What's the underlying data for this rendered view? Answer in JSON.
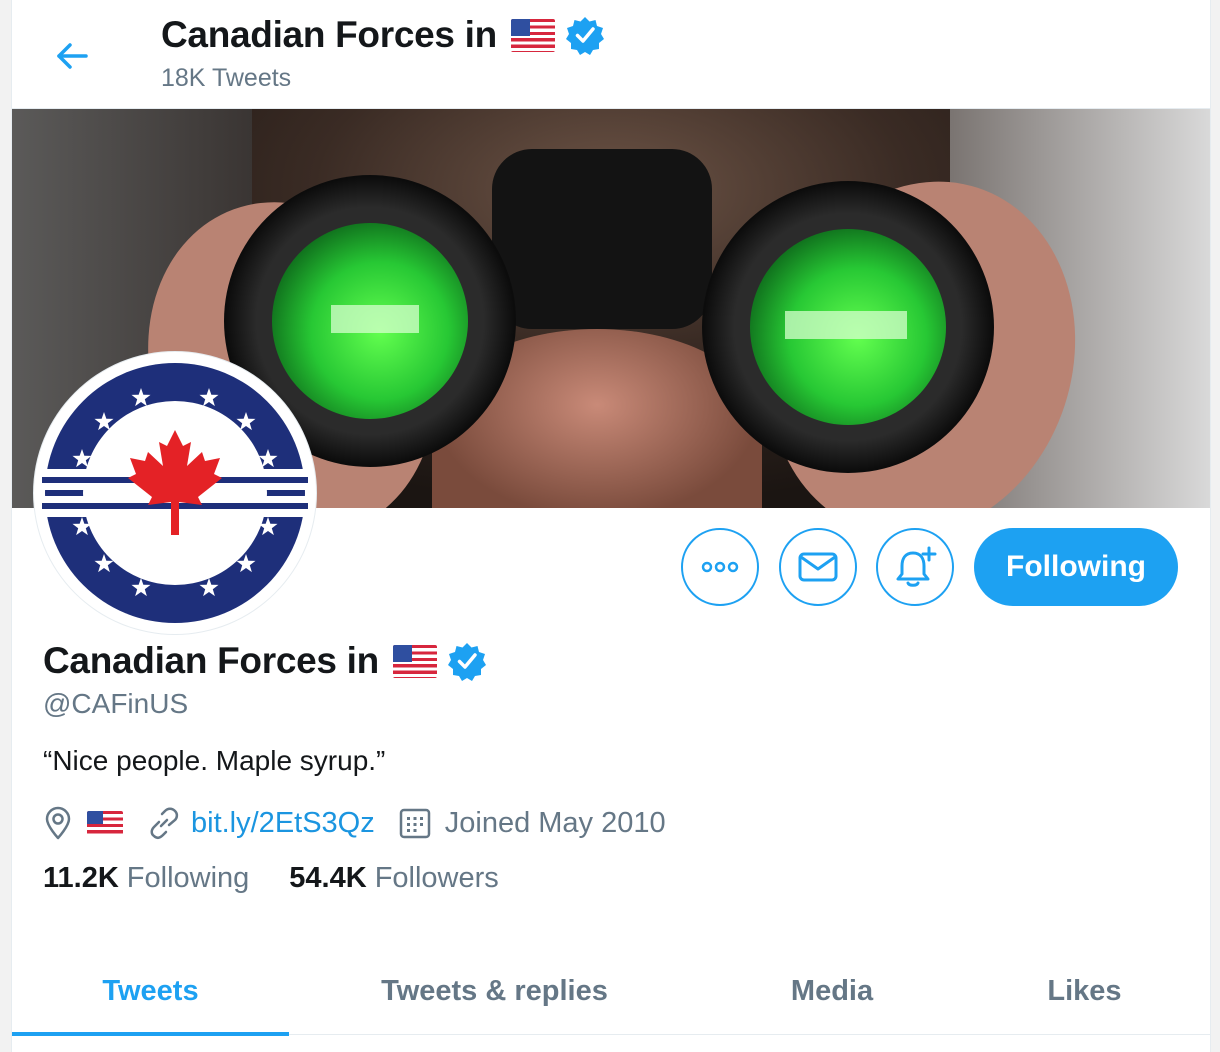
{
  "header": {
    "back_label": "Back",
    "title": "Canadian Forces in",
    "tweet_count": "18K Tweets"
  },
  "profile": {
    "name": "Canadian Forces in",
    "handle": "@CAFinUS",
    "bio": "“Nice people. Maple syrup.”",
    "location_flag": "us-flag-icon",
    "website": "bit.ly/2EtS3Qz",
    "joined": "Joined May 2010",
    "following_count": "11.2K",
    "following_label": "Following",
    "followers_count": "54.4K",
    "followers_label": "Followers"
  },
  "actions": {
    "more_icon": "more-icon",
    "message_icon": "mail-icon",
    "notify_icon": "bell-plus-icon",
    "follow_label": "Following"
  },
  "tabs": [
    {
      "label": "Tweets",
      "active": true
    },
    {
      "label": "Tweets & replies",
      "active": false
    },
    {
      "label": "Media",
      "active": false
    },
    {
      "label": "Likes",
      "active": false
    }
  ],
  "colors": {
    "accent": "#1da1f2",
    "secondary_text": "#657786",
    "primary_text": "#14171a",
    "logo_blue": "#1e2f7a",
    "logo_red": "#e42226"
  }
}
